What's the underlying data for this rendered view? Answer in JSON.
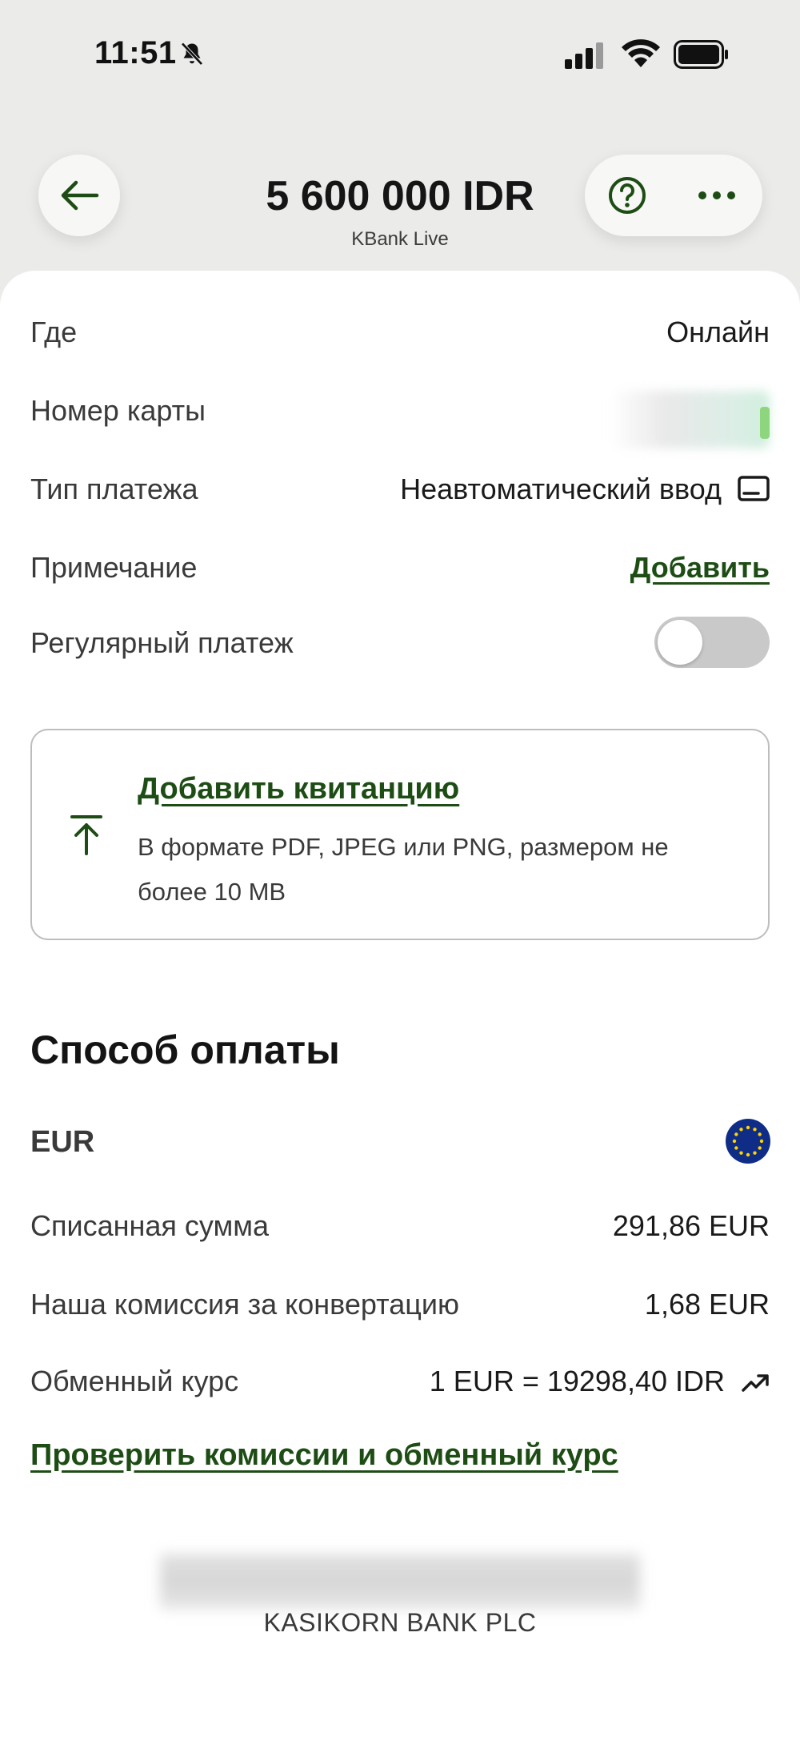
{
  "status_bar": {
    "time": "11:51"
  },
  "header": {
    "amount": "5 600 000 IDR",
    "merchant": "KBank Live"
  },
  "details": {
    "where_label": "Где",
    "where_value": "Онлайн",
    "card_label": "Номер карты",
    "payment_type_label": "Тип платежа",
    "payment_type_value": "Неавтоматический ввод",
    "note_label": "Примечание",
    "note_action": "Добавить",
    "recurring_label": "Регулярный платеж",
    "recurring_enabled": false
  },
  "receipt": {
    "title": "Добавить квитанцию",
    "description": "В формате PDF, JPEG или PNG, размером не более 10 MB"
  },
  "payment_method": {
    "title": "Способ оплаты",
    "currency": "EUR",
    "debited_label": "Списанная сумма",
    "debited_value": "291,86 EUR",
    "fee_label": "Наша комиссия за конвертацию",
    "fee_value": "1,68 EUR",
    "rate_label": "Обменный курс",
    "rate_value": "1 EUR = 19298,40 IDR",
    "check_link": "Проверить комиссии и обменный курс"
  },
  "footer": {
    "bank": "KASIKORN BANK PLC"
  },
  "colors": {
    "accent": "#1d4d14",
    "background": "#ebebea",
    "eu_blue": "#0f2d86",
    "eu_star": "#ffd400"
  }
}
